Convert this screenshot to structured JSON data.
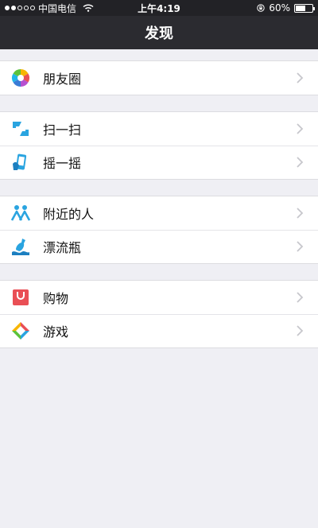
{
  "status": {
    "carrier": "中国电信",
    "time": "上午4:19",
    "battery": "60%",
    "battery_level": 0.6
  },
  "nav": {
    "title": "发现"
  },
  "groups": [
    {
      "items": [
        {
          "label": "朋友圈",
          "icon": "moments-icon"
        }
      ]
    },
    {
      "items": [
        {
          "label": "扫一扫",
          "icon": "scan-icon"
        },
        {
          "label": "摇一摇",
          "icon": "shake-icon"
        }
      ]
    },
    {
      "items": [
        {
          "label": "附近的人",
          "icon": "people-nearby-icon"
        },
        {
          "label": "漂流瓶",
          "icon": "drift-bottle-icon"
        }
      ]
    },
    {
      "items": [
        {
          "label": "购物",
          "icon": "shopping-icon"
        },
        {
          "label": "游戏",
          "icon": "games-icon"
        }
      ]
    }
  ],
  "colors": {
    "nav_bg": "#2b2b30",
    "page_bg": "#efeff4",
    "scan_blue": "#2aa4e0",
    "shop_red": "#e94f55"
  }
}
